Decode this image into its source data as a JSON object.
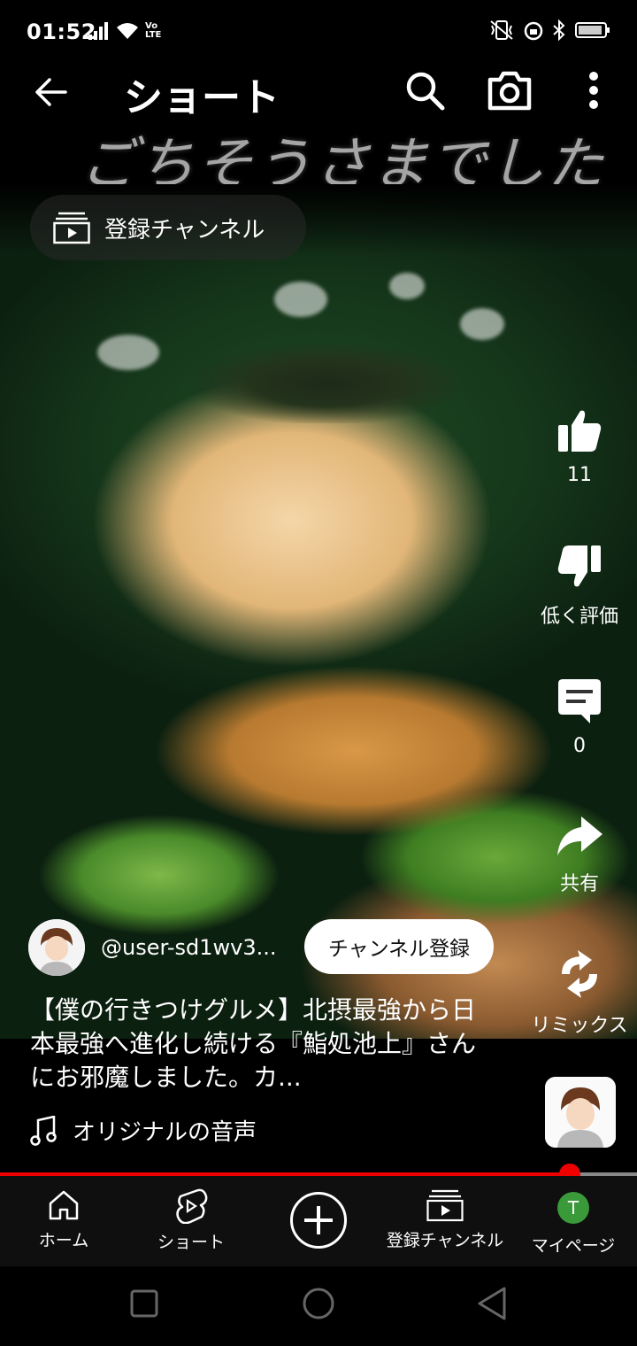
{
  "status_bar": {
    "time": "01:52",
    "network_label": "Vo LTE",
    "icons": [
      "signal-icon",
      "wifi-icon",
      "vibrate-icon",
      "alarm-icon",
      "bluetooth-icon",
      "battery-icon"
    ]
  },
  "header": {
    "title": "ショート",
    "overlay_caption": "ごちそうさまでした",
    "icons": [
      "back-arrow-icon",
      "search-icon",
      "camera-icon",
      "more-vert-icon"
    ]
  },
  "video": {
    "subscriptions_chip": "登録チャンネル"
  },
  "actions": {
    "like_count": "11",
    "dislike_label": "低く評価",
    "comment_count": "0",
    "share_label": "共有",
    "remix_label": "リミックス"
  },
  "channel": {
    "handle": "@user-sd1wv3...",
    "subscribe_label": "チャンネル登録"
  },
  "video_title": "【僕の行きつけグルメ】北摂最強から日本最強へ進化し続ける『鮨処池上』さんにお邪魔しました。カ...",
  "music": {
    "label": "オリジナルの音声"
  },
  "progress": {
    "fraction": 0.895
  },
  "bottom_nav": {
    "items": [
      {
        "label": "ホーム",
        "icon": "home-icon"
      },
      {
        "label": "ショート",
        "icon": "shorts-icon"
      },
      {
        "label": "",
        "icon": "create-plus-icon"
      },
      {
        "label": "登録チャンネル",
        "icon": "subscriptions-icon"
      },
      {
        "label": "マイページ",
        "icon": "account-avatar",
        "avatar_letter": "T"
      }
    ]
  },
  "colors": {
    "accent_red": "#ee0000",
    "background": "#000000",
    "nav_background": "#0f0f0f",
    "avatar_green": "#3a9a3a"
  }
}
